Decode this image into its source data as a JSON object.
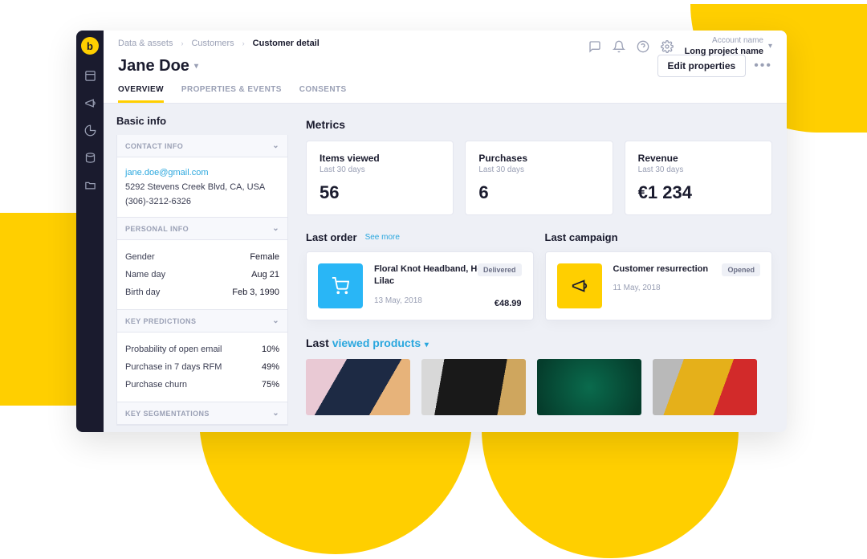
{
  "breadcrumbs": {
    "a": "Data & assets",
    "b": "Customers",
    "c": "Customer detail"
  },
  "account": {
    "label": "Account name",
    "project": "Long project name"
  },
  "titlebar": {
    "name": "Jane Doe",
    "edit_btn": "Edit properties"
  },
  "tabs": {
    "overview": "OVERVIEW",
    "properties": "PROPERTIES & EVENTS",
    "consents": "CONSENTS"
  },
  "basic_info": {
    "title": "Basic info",
    "contact": {
      "head": "CONTACT INFO",
      "email": "jane.doe@gmail.com",
      "address": "5292 Stevens Creek Blvd, CA, USA",
      "phone": "(306)-3212-6326"
    },
    "personal": {
      "head": "PERSONAL INFO",
      "gender_k": "Gender",
      "gender_v": "Female",
      "nameday_k": "Name day",
      "nameday_v": "Aug 21",
      "birthday_k": "Birth day",
      "birthday_v": "Feb 3, 1990"
    },
    "predictions": {
      "head": "KEY PREDICTIONS",
      "p1_k": "Probability of open email",
      "p1_v": "10%",
      "p2_k": "Purchase in 7 days RFM",
      "p2_v": "49%",
      "p3_k": "Purchase churn",
      "p3_v": "75%"
    },
    "segmentations": {
      "head": "KEY SEGMENTATIONS"
    }
  },
  "metrics": {
    "title": "Metrics",
    "sub": "Last 30 days",
    "m1_label": "Items viewed",
    "m1_val": "56",
    "m2_label": "Purchases",
    "m2_val": "6",
    "m3_label": "Revenue",
    "m3_val": "€1 234"
  },
  "last_order": {
    "head": "Last order",
    "see_more": "See more",
    "title": "Floral Knot Headband, Hoodie in Lilac",
    "date": "13 May, 2018",
    "price": "€48.99",
    "badge": "Delivered"
  },
  "last_campaign": {
    "head": "Last campaign",
    "title": "Customer resurrection",
    "date": "11 May, 2018",
    "badge": "Opened"
  },
  "last_viewed": {
    "prefix": "Last ",
    "accent": "viewed products"
  }
}
